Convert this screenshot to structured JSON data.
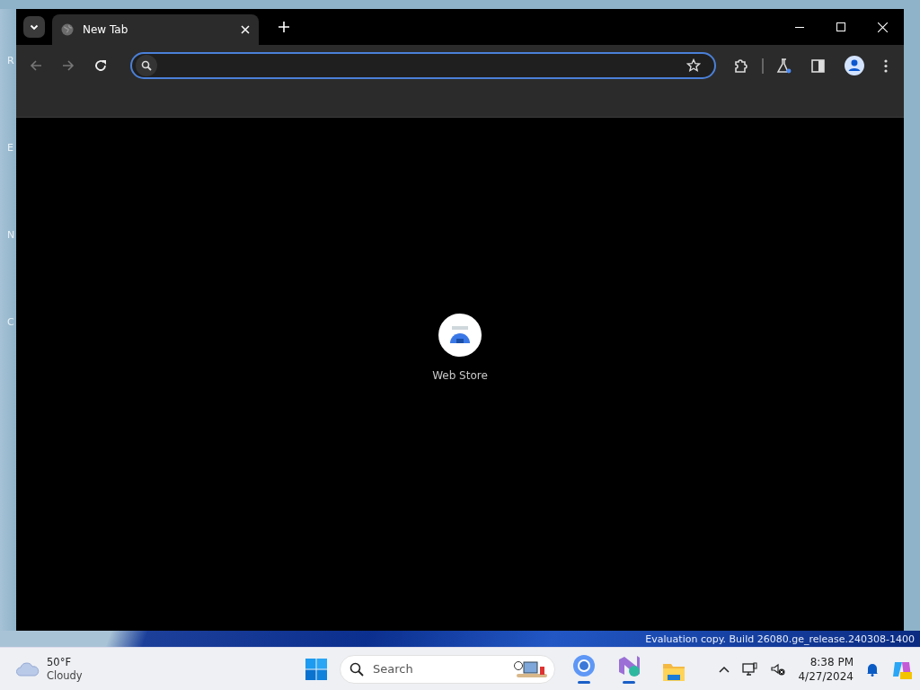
{
  "desktop": {
    "icon_labels": [
      "R",
      "E",
      "N",
      "C"
    ],
    "notice": "Evaluation copy. Build 26080.ge_release.240308-1400"
  },
  "browser": {
    "tabs": [
      {
        "title": "New Tab",
        "selected": true
      }
    ],
    "address_bar": {
      "focused": true
    },
    "shortcuts": [
      {
        "label": "Web Store"
      }
    ]
  },
  "taskbar": {
    "weather": {
      "temperature": "50°F",
      "condition": "Cloudy"
    },
    "search": {
      "placeholder": "Search"
    },
    "apps": [
      {
        "kind": "chromium",
        "running": true
      },
      {
        "kind": "studio",
        "running": true
      },
      {
        "kind": "folder",
        "running": false
      }
    ],
    "clock": {
      "time": "8:38 PM",
      "date": "4/27/2024"
    }
  }
}
